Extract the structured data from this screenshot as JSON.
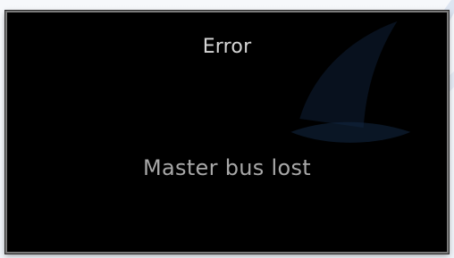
{
  "dialog": {
    "title": "Error",
    "message": "Master bus lost"
  },
  "colors": {
    "dialog_background": "#000000",
    "dialog_border": "#7a7a7a",
    "title_text": "#d6d6d6",
    "message_text": "#a8a8a8",
    "background_mark": "#1a2e4d"
  },
  "icons": {
    "background_mark": "sailboat-logo-watermark"
  }
}
